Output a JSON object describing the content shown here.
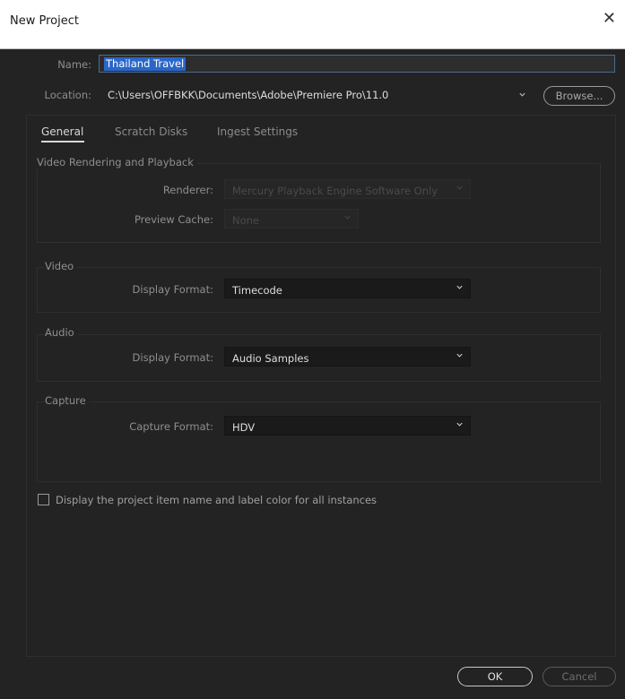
{
  "window": {
    "title": "New Project",
    "close_symbol": "✕"
  },
  "name": {
    "label": "Name:",
    "value": "Thailand Travel"
  },
  "location": {
    "label": "Location:",
    "value": "C:\\Users\\OFFBKK\\Documents\\Adobe\\Premiere Pro\\11.0",
    "browse_label": "Browse..."
  },
  "tabs": [
    {
      "label": "General",
      "active": true
    },
    {
      "label": "Scratch Disks",
      "active": false
    },
    {
      "label": "Ingest Settings",
      "active": false
    }
  ],
  "video_rendering": {
    "title": "Video Rendering and Playback",
    "renderer_label": "Renderer:",
    "renderer_value": "Mercury Playback Engine Software Only",
    "preview_cache_label": "Preview Cache:",
    "preview_cache_value": "None"
  },
  "video": {
    "title": "Video",
    "display_format_label": "Display Format:",
    "display_format_value": "Timecode"
  },
  "audio": {
    "title": "Audio",
    "display_format_label": "Display Format:",
    "display_format_value": "Audio Samples"
  },
  "capture": {
    "title": "Capture",
    "capture_format_label": "Capture Format:",
    "capture_format_value": "HDV"
  },
  "display_item_name": {
    "label": "Display the project item name and label color for all instances",
    "checked": false
  },
  "footer": {
    "ok_label": "OK",
    "cancel_label": "Cancel"
  },
  "colors": {
    "dialog_bg": "#232323",
    "selection": "#2a66c9",
    "text_muted": "#8f8f8f"
  }
}
